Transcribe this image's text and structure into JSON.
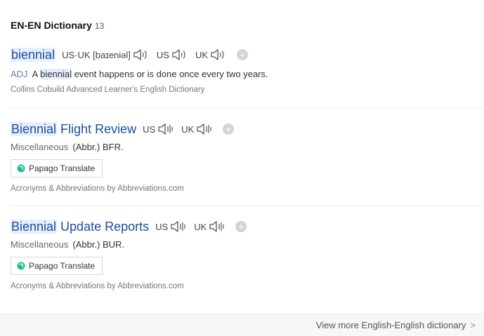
{
  "header": {
    "title": "EN-EN Dictionary",
    "count": "13"
  },
  "entries": [
    {
      "headword_hl": "biennial",
      "headword_rest": "",
      "pron_label": "US·UK [baɪeniəl]",
      "us_label": "US",
      "uk_label": "UK",
      "pos": "ADJ",
      "def_pre": "A ",
      "def_hl": "biennial",
      "def_post": " event happens or is done once every two years.",
      "source": "Collins Cobuild Advanced Learner's English Dictionary"
    },
    {
      "headword_hl": "Biennial",
      "headword_rest": " Flight Review",
      "us_label": "US",
      "uk_label": "UK",
      "category": "Miscellaneous",
      "abbr": "(Abbr.) BFR.",
      "translate_label": "Papago Translate",
      "source": "Acronyms & Abbreviations by Abbreviations.com"
    },
    {
      "headword_hl": "Biennial",
      "headword_rest": " Update Reports",
      "us_label": "US",
      "uk_label": "UK",
      "category": "Miscellaneous",
      "abbr": "(Abbr.) BUR.",
      "translate_label": "Papago Translate",
      "source": "Acronyms & Abbreviations by Abbreviations.com"
    }
  ],
  "icons": {
    "speaker": "speaker-icon",
    "add": "plus-icon",
    "papago": "papago-icon",
    "chevron": "chevron-right-icon"
  },
  "footer": {
    "more_label": "View more English-English dictionary",
    "chevron": ">"
  },
  "colors": {
    "link": "#1d4fa0",
    "highlight": "#e6eefb"
  }
}
